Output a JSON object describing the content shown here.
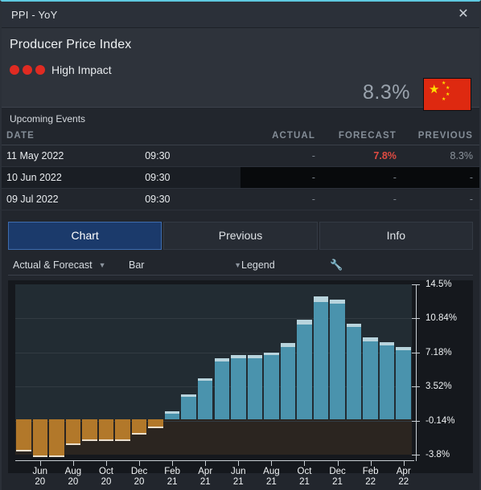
{
  "window": {
    "title": "PPI - YoY",
    "close_icon": "close-icon"
  },
  "header": {
    "name": "Producer Price Index",
    "impact_label": "High Impact",
    "impact_dots": 3,
    "current_value": "8.3%",
    "country": "China",
    "flag_colors": {
      "field": "#de2910",
      "star": "#ffde00"
    }
  },
  "events": {
    "section_title": "Upcoming Events",
    "columns": [
      "DATE",
      "",
      "ACTUAL",
      "FORECAST",
      "PREVIOUS"
    ],
    "rows": [
      {
        "date": "11 May 2022",
        "time": "09:30",
        "actual": "-",
        "forecast": "7.8%",
        "previous": "8.3%",
        "highlight": false
      },
      {
        "date": "10 Jun 2022",
        "time": "09:30",
        "actual": "-",
        "forecast": "-",
        "previous": "-",
        "highlight": true
      },
      {
        "date": "09 Jul 2022",
        "time": "09:30",
        "actual": "-",
        "forecast": "-",
        "previous": "-",
        "highlight": false
      }
    ]
  },
  "tabs": [
    {
      "label": "Chart",
      "active": true
    },
    {
      "label": "Previous",
      "active": false
    },
    {
      "label": "Info",
      "active": false
    }
  ],
  "controls": {
    "series_select": "Actual & Forecast",
    "type_select": "Bar",
    "legend_label": "Legend",
    "settings_icon": "wrench-icon",
    "caret": "▼"
  },
  "chart_data": {
    "type": "bar",
    "title": "",
    "xlabel": "",
    "ylabel": "",
    "ylim": [
      -3.8,
      14.5
    ],
    "yticks": [
      14.5,
      10.84,
      7.18,
      3.52,
      -0.14,
      -3.8
    ],
    "ytick_labels": [
      "14.5%",
      "10.84%",
      "7.18%",
      "3.52%",
      "-0.14%",
      "-3.8%"
    ],
    "grid": true,
    "legend": [
      "Actual",
      "Forecast"
    ],
    "colors": {
      "positive": "#4a93ad",
      "positive_forecast": "#b8d4dd",
      "negative": "#b2782a",
      "negative_forecast": "#ece0cd",
      "plot_positive_bg": "#222c33",
      "plot_negative_bg": "#2b2520"
    },
    "xtick_labels": [
      "Jun\n20",
      "Aug\n20",
      "Oct\n20",
      "Dec\n20",
      "Feb\n21",
      "Apr\n21",
      "Jun\n21",
      "Aug\n21",
      "Oct\n21",
      "Dec\n21",
      "Feb\n22",
      "Apr\n22"
    ],
    "categories": [
      "May 20",
      "Jun 20",
      "Jul 20",
      "Aug 20",
      "Sep 20",
      "Oct 20",
      "Nov 20",
      "Dec 20",
      "Jan 21",
      "Feb 21",
      "Mar 21",
      "Apr 21",
      "May 21",
      "Jun 21",
      "Jul 21",
      "Aug 21",
      "Sep 21",
      "Oct 21",
      "Nov 21",
      "Dec 21",
      "Jan 22",
      "Feb 22",
      "Mar 22",
      "Apr 22"
    ],
    "series": [
      {
        "name": "Actual",
        "values": [
          -3.1,
          -3.7,
          -3.6,
          -2.4,
          -2.1,
          -2.1,
          -2.0,
          -1.2,
          -0.5,
          0.9,
          2.7,
          4.4,
          6.6,
          6.9,
          6.9,
          7.2,
          8.2,
          10.7,
          13.2,
          12.9,
          10.3,
          8.8,
          8.3,
          7.8
        ]
      },
      {
        "name": "Forecast",
        "values": [
          -3.3,
          -3.9,
          -3.9,
          -2.6,
          -2.2,
          -2.2,
          -2.2,
          -1.5,
          -0.8,
          0.6,
          2.4,
          4.1,
          6.2,
          6.6,
          6.6,
          6.9,
          7.8,
          10.2,
          12.6,
          12.4,
          9.9,
          8.4,
          7.9,
          7.4
        ]
      }
    ]
  }
}
